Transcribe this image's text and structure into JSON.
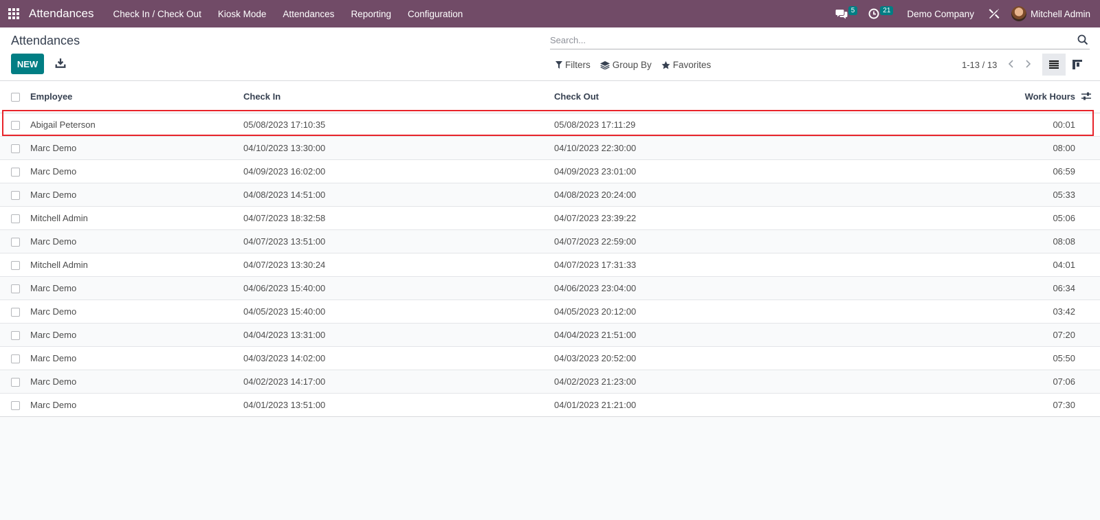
{
  "navbar": {
    "app_title": "Attendances",
    "menu": [
      "Check In / Check Out",
      "Kiosk Mode",
      "Attendances",
      "Reporting",
      "Configuration"
    ],
    "messages_count": "5",
    "activities_count": "21",
    "company": "Demo Company",
    "user": "Mitchell Admin"
  },
  "control_panel": {
    "breadcrumb": "Attendances",
    "new_label": "NEW",
    "search_placeholder": "Search...",
    "filters_label": "Filters",
    "group_by_label": "Group By",
    "favorites_label": "Favorites",
    "pager": "1-13 / 13"
  },
  "table": {
    "headers": {
      "employee": "Employee",
      "check_in": "Check In",
      "check_out": "Check Out",
      "work_hours": "Work Hours"
    },
    "rows": [
      {
        "employee": "Abigail Peterson",
        "check_in": "05/08/2023 17:10:35",
        "check_out": "05/08/2023 17:11:29",
        "hours": "00:01"
      },
      {
        "employee": "Marc Demo",
        "check_in": "04/10/2023 13:30:00",
        "check_out": "04/10/2023 22:30:00",
        "hours": "08:00"
      },
      {
        "employee": "Marc Demo",
        "check_in": "04/09/2023 16:02:00",
        "check_out": "04/09/2023 23:01:00",
        "hours": "06:59"
      },
      {
        "employee": "Marc Demo",
        "check_in": "04/08/2023 14:51:00",
        "check_out": "04/08/2023 20:24:00",
        "hours": "05:33"
      },
      {
        "employee": "Mitchell Admin",
        "check_in": "04/07/2023 18:32:58",
        "check_out": "04/07/2023 23:39:22",
        "hours": "05:06"
      },
      {
        "employee": "Marc Demo",
        "check_in": "04/07/2023 13:51:00",
        "check_out": "04/07/2023 22:59:00",
        "hours": "08:08"
      },
      {
        "employee": "Mitchell Admin",
        "check_in": "04/07/2023 13:30:24",
        "check_out": "04/07/2023 17:31:33",
        "hours": "04:01"
      },
      {
        "employee": "Marc Demo",
        "check_in": "04/06/2023 15:40:00",
        "check_out": "04/06/2023 23:04:00",
        "hours": "06:34"
      },
      {
        "employee": "Marc Demo",
        "check_in": "04/05/2023 15:40:00",
        "check_out": "04/05/2023 20:12:00",
        "hours": "03:42"
      },
      {
        "employee": "Marc Demo",
        "check_in": "04/04/2023 13:31:00",
        "check_out": "04/04/2023 21:51:00",
        "hours": "07:20"
      },
      {
        "employee": "Marc Demo",
        "check_in": "04/03/2023 14:02:00",
        "check_out": "04/03/2023 20:52:00",
        "hours": "05:50"
      },
      {
        "employee": "Marc Demo",
        "check_in": "04/02/2023 14:17:00",
        "check_out": "04/02/2023 21:23:00",
        "hours": "07:06"
      },
      {
        "employee": "Marc Demo",
        "check_in": "04/01/2023 13:51:00",
        "check_out": "04/01/2023 21:21:00",
        "hours": "07:30"
      }
    ]
  },
  "colors": {
    "navbar": "#714b67",
    "primary": "#017e84",
    "highlight": "#e8232a"
  }
}
